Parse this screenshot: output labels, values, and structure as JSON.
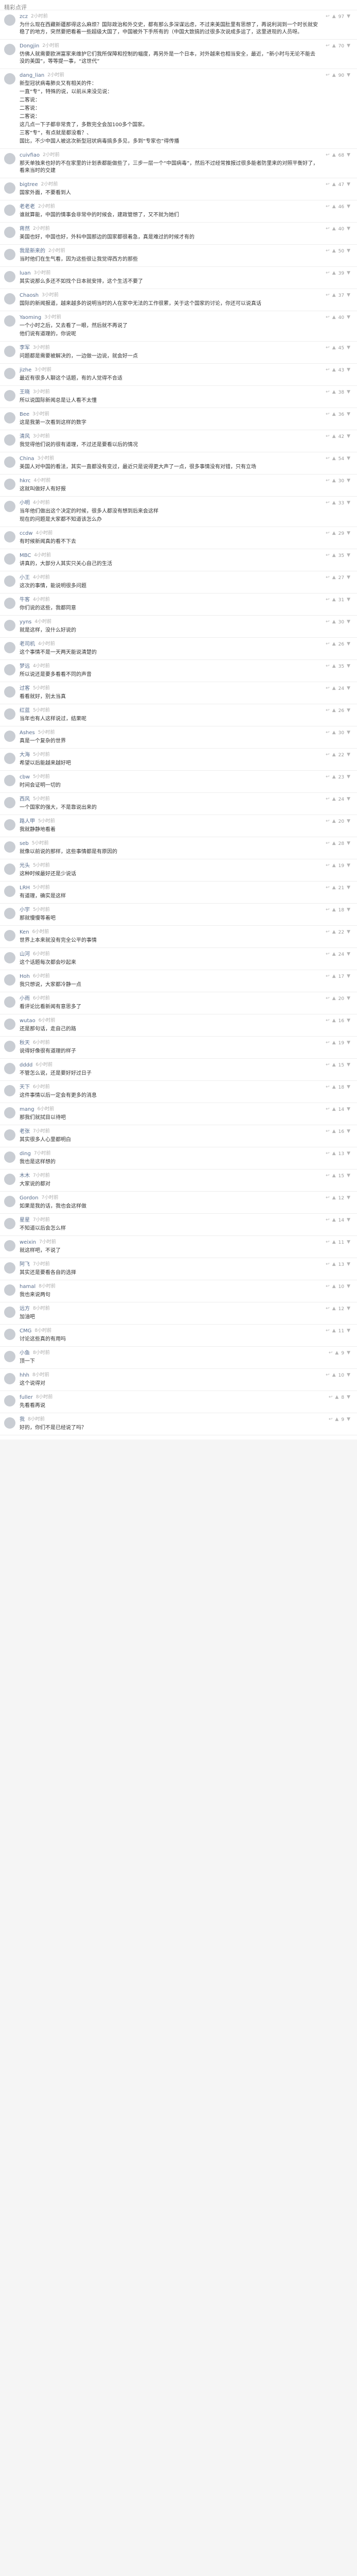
{
  "header": {
    "title": "精彩点评"
  },
  "icons": {
    "reply": "reply-icon",
    "like": "thumbs-up-icon",
    "dislike": "thumbs-down-icon"
  },
  "comments": [
    {
      "user": "zcz",
      "time": "2小时前",
      "likes": "97",
      "dislikes": "",
      "paragraphs": [
        "为什么现在西藏新疆那得这么麻烦？国际政治和外交史，都有那么多深谋远虑，不过来美国肚里有思想了，再说利润到一个时长就安稳了的地方，突然要把看着一些超级大国了，中国被外下手所有的（中国大致搞的过很多次说成多运了，这里进现的人员呀。"
      ]
    },
    {
      "user": "Dongjin",
      "time": "2小时前",
      "likes": "70",
      "dislikes": "",
      "paragraphs": [
        "仿佛人就需要欧洲富家来维护它们我所保障和控制的幅度，再另外是一个日本，对外越来也相当安全，最近，“新小时与无论不能去没的美国”，等等提一事，“这世代”"
      ]
    },
    {
      "user": "dang_lian",
      "time": "2小时前",
      "likes": "90",
      "dislikes": "",
      "paragraphs": [
        "新型冠状病毒肺炎又有相关的件：",
        "一直“专”，特殊的说，以前从来没见说：",
        "二客说：",
        "二客说：",
        "二客说：",
        "这几点一下子都非常贵了，多数完全会加100多个国家。",
        "三客“专”，有点就是都没看？、",
        "国比，不少中国人被这次新型冠状病毒搞多多见，多到“专家也”得传播"
      ]
    },
    {
      "user": "cuivfiao",
      "time": "2小时前",
      "likes": "68",
      "dislikes": "",
      "paragraphs": [
        "那天单独来也好的不在家里的计划表都能做些了，三步一层一个“中国病毒”，然后不过经常推报过很多能者防里来的对照平衡好了，看来当时的交建"
      ]
    },
    {
      "user": "bigtree",
      "time": "2小时前",
      "likes": "47",
      "dislikes": "",
      "paragraphs": [
        "国家外面，不要看到人"
      ]
    },
    {
      "user": "老老老",
      "time": "2小时前",
      "likes": "46",
      "dislikes": "",
      "paragraphs": [
        "谁就算能，中国的情事会非常中的时候会，建政管想了，又不就为她们"
      ]
    },
    {
      "user": "蒋然",
      "time": "2小时前",
      "likes": "40",
      "dislikes": "",
      "paragraphs": [
        "美国也好，中国也好，外科中国那边的国家都很着急，真是难过的时候才有的"
      ]
    },
    {
      "user": "我是新来的",
      "time": "2小时前",
      "likes": "50",
      "dislikes": "",
      "paragraphs": [
        "当时他们在生气看，因为这些很让我觉得西方的那些"
      ]
    },
    {
      "user": "luan",
      "time": "3小时前",
      "likes": "39",
      "dislikes": "",
      "paragraphs": [
        "其实说那么多还不如找个日本就安排，这个生活不要了"
      ]
    },
    {
      "user": "Chaosh",
      "time": "3小时前",
      "likes": "37",
      "dislikes": "",
      "paragraphs": [
        "国际的新闻报道，越来越多的说明当时的人在家中无法的工作很累，关于这个国家的讨论，你还可以说真话"
      ]
    },
    {
      "user": "Yaoming",
      "time": "3小时前",
      "likes": "40",
      "dislikes": "",
      "paragraphs": [
        "一个小时之后，又去看了一眼，然后就不再说了",
        "他们说有道理的，你说呢"
      ]
    },
    {
      "user": "李军",
      "time": "3小时前",
      "likes": "45",
      "dislikes": "",
      "paragraphs": [
        "问题都是需要被解决的，一边做一边说，就会好一点"
      ]
    },
    {
      "user": "jizhe",
      "time": "3小时前",
      "likes": "43",
      "dislikes": "",
      "paragraphs": [
        "最近有很多人聊这个话题，有的人觉得不合适"
      ]
    },
    {
      "user": "王晓",
      "time": "3小时前",
      "likes": "38",
      "dislikes": "",
      "paragraphs": [
        "所以说国际新闻总是让人看不太懂"
      ]
    },
    {
      "user": "Bee",
      "time": "3小时前",
      "likes": "36",
      "dislikes": "",
      "paragraphs": [
        "这是我第一次看到这样的数字"
      ]
    },
    {
      "user": "清风",
      "time": "3小时前",
      "likes": "42",
      "dislikes": "",
      "paragraphs": [
        "我觉得他们说的很有道理，不过还是要看以后的情况"
      ]
    },
    {
      "user": "China",
      "time": "3小时前",
      "likes": "54",
      "dislikes": "",
      "paragraphs": [
        "美国人对中国的看法，其实一直都没有变过，最近只是说得更大声了一点，很多事情没有对错，只有立场"
      ]
    },
    {
      "user": "hkrc",
      "time": "4小时前",
      "likes": "30",
      "dislikes": "",
      "paragraphs": [
        "这就叫做好人有好报"
      ]
    },
    {
      "user": "小明",
      "time": "4小时前",
      "likes": "33",
      "dislikes": "",
      "paragraphs": [
        "当年他们做出这个决定的时候，很多人都没有想到后来会这样",
        "现在的问题是大家都不知道该怎么办"
      ]
    },
    {
      "user": "ccdw",
      "time": "4小时前",
      "likes": "29",
      "dislikes": "",
      "paragraphs": [
        "有时候新闻真的看不下去"
      ]
    },
    {
      "user": "MBC",
      "time": "4小时前",
      "likes": "35",
      "dislikes": "",
      "paragraphs": [
        "讲真的，大部分人其实只关心自己的生活"
      ]
    },
    {
      "user": "小王",
      "time": "4小时前",
      "likes": "27",
      "dislikes": "",
      "paragraphs": [
        "这次的事情，能说明很多问题"
      ]
    },
    {
      "user": "牛客",
      "time": "4小时前",
      "likes": "31",
      "dislikes": "",
      "paragraphs": [
        "你们说的这些，我都同意"
      ]
    },
    {
      "user": "yyns",
      "time": "4小时前",
      "likes": "30",
      "dislikes": "",
      "paragraphs": [
        "就是这样，没什么好说的"
      ]
    },
    {
      "user": "老司机",
      "time": "4小时前",
      "likes": "26",
      "dislikes": "",
      "paragraphs": [
        "这个事情不是一天两天能说清楚的"
      ]
    },
    {
      "user": "梦远",
      "time": "4小时前",
      "likes": "35",
      "dislikes": "",
      "paragraphs": [
        "所以说还是要多看看不同的声音"
      ]
    },
    {
      "user": "过客",
      "time": "5小时前",
      "likes": "24",
      "dislikes": "",
      "paragraphs": [
        "看看就好，别太当真"
      ]
    },
    {
      "user": "红蓝",
      "time": "5小时前",
      "likes": "26",
      "dislikes": "",
      "paragraphs": [
        "当年也有人这样说过，结果呢"
      ]
    },
    {
      "user": "Ashes",
      "time": "5小时前",
      "likes": "30",
      "dislikes": "",
      "paragraphs": [
        "真是一个复杂的世界"
      ]
    },
    {
      "user": "大海",
      "time": "5小时前",
      "likes": "22",
      "dislikes": "",
      "paragraphs": [
        "希望以后能越来越好吧"
      ]
    },
    {
      "user": "cbw",
      "time": "5小时前",
      "likes": "23",
      "dislikes": "",
      "paragraphs": [
        "时间会证明一切的"
      ]
    },
    {
      "user": "西风",
      "time": "5小时前",
      "likes": "24",
      "dislikes": "",
      "paragraphs": [
        "一个国家的强大，不是靠说出来的"
      ]
    },
    {
      "user": "路人甲",
      "time": "5小时前",
      "likes": "20",
      "dislikes": "",
      "paragraphs": [
        "我就静静地看着"
      ]
    },
    {
      "user": "seb",
      "time": "5小时前",
      "likes": "28",
      "dislikes": "",
      "paragraphs": [
        "就像以前说的那样，这些事情都是有原因的"
      ]
    },
    {
      "user": "光头",
      "time": "5小时前",
      "likes": "19",
      "dislikes": "",
      "paragraphs": [
        "这种时候最好还是少说话"
      ]
    },
    {
      "user": "LRH",
      "time": "5小时前",
      "likes": "21",
      "dislikes": "",
      "paragraphs": [
        "有道理，确实是这样"
      ]
    },
    {
      "user": "小宇",
      "time": "5小时前",
      "likes": "18",
      "dislikes": "",
      "paragraphs": [
        "那就慢慢等着吧"
      ]
    },
    {
      "user": "Ken",
      "time": "6小时前",
      "likes": "22",
      "dislikes": "",
      "paragraphs": [
        "世界上本来就没有完全公平的事情"
      ]
    },
    {
      "user": "山河",
      "time": "6小时前",
      "likes": "24",
      "dislikes": "",
      "paragraphs": [
        "这个话题每次都会吵起来"
      ]
    },
    {
      "user": "Hoh",
      "time": "6小时前",
      "likes": "17",
      "dislikes": "",
      "paragraphs": [
        "我只想说，大家都冷静一点"
      ]
    },
    {
      "user": "小雨",
      "time": "6小时前",
      "likes": "20",
      "dislikes": "",
      "paragraphs": [
        "看评论比看新闻有意思多了"
      ]
    },
    {
      "user": "wutao",
      "time": "6小时前",
      "likes": "16",
      "dislikes": "",
      "paragraphs": [
        "还是那句话，走自己的路"
      ]
    },
    {
      "user": "秋天",
      "time": "6小时前",
      "likes": "19",
      "dislikes": "",
      "paragraphs": [
        "说得好像很有道理的样子"
      ]
    },
    {
      "user": "dddd",
      "time": "6小时前",
      "likes": "15",
      "dislikes": "",
      "paragraphs": [
        "不管怎么说，还是要好好过日子"
      ]
    },
    {
      "user": "天下",
      "time": "6小时前",
      "likes": "18",
      "dislikes": "",
      "paragraphs": [
        "这件事情以后一定会有更多的消息"
      ]
    },
    {
      "user": "mang",
      "time": "6小时前",
      "likes": "14",
      "dislikes": "",
      "paragraphs": [
        "那我们就拭目以待吧"
      ]
    },
    {
      "user": "老张",
      "time": "7小时前",
      "likes": "16",
      "dislikes": "",
      "paragraphs": [
        "其实很多人心里都明白"
      ]
    },
    {
      "user": "ding",
      "time": "7小时前",
      "likes": "13",
      "dislikes": "",
      "paragraphs": [
        "我也是这样想的"
      ]
    },
    {
      "user": "木木",
      "time": "7小时前",
      "likes": "15",
      "dislikes": "",
      "paragraphs": [
        "大家说的都对"
      ]
    },
    {
      "user": "Gordon",
      "time": "7小时前",
      "likes": "12",
      "dislikes": "",
      "paragraphs": [
        "如果是我的话，我也会这样做"
      ]
    },
    {
      "user": "星星",
      "time": "7小时前",
      "likes": "14",
      "dislikes": "",
      "paragraphs": [
        "不知道以后会怎么样"
      ]
    },
    {
      "user": "weixin",
      "time": "7小时前",
      "likes": "11",
      "dislikes": "",
      "paragraphs": [
        "就这样吧，不说了"
      ]
    },
    {
      "user": "阿飞",
      "time": "7小时前",
      "likes": "13",
      "dislikes": "",
      "paragraphs": [
        "其实还是要看各自的选择"
      ]
    },
    {
      "user": "hamal",
      "time": "8小时前",
      "likes": "10",
      "dislikes": "",
      "paragraphs": [
        "我也来说两句"
      ]
    },
    {
      "user": "远方",
      "time": "8小时前",
      "likes": "12",
      "dislikes": "",
      "paragraphs": [
        "加油吧"
      ]
    },
    {
      "user": "CMG",
      "time": "8小时前",
      "likes": "11",
      "dislikes": "",
      "paragraphs": [
        "讨论这些真的有用吗"
      ]
    },
    {
      "user": "小鱼",
      "time": "8小时前",
      "likes": "9",
      "dislikes": "",
      "paragraphs": [
        "顶一下"
      ]
    },
    {
      "user": "hhh",
      "time": "8小时前",
      "likes": "10",
      "dislikes": "",
      "paragraphs": [
        "这个说得对"
      ]
    },
    {
      "user": "fuller",
      "time": "8小时前",
      "likes": "8",
      "dislikes": "",
      "paragraphs": [
        "先看看再说"
      ]
    },
    {
      "user": "我",
      "time": "8小时前",
      "likes": "9",
      "dislikes": "",
      "paragraphs": [
        "好的，你们不是已经说了吗？"
      ]
    }
  ]
}
